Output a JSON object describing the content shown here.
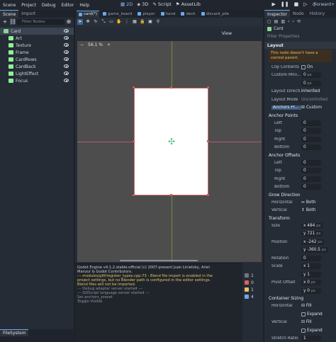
{
  "menubar": {
    "items": [
      "Scene",
      "Project",
      "Debug",
      "Editor",
      "Help"
    ]
  },
  "workspace": {
    "buttons": [
      "2D",
      "3D",
      "Script",
      "AssetLib"
    ],
    "active": "2D"
  },
  "renderer": "Forward+",
  "left_dock": {
    "tabs": [
      "Scene",
      "Import"
    ],
    "filter_placeholder": "Filter Nodes",
    "nodes": [
      {
        "label": "Card",
        "color": "#8bd49b",
        "selected": true
      },
      {
        "label": "Art",
        "color": "#8eef97"
      },
      {
        "label": "Texture",
        "color": "#8eef97"
      },
      {
        "label": "Frame",
        "color": "#8eef97"
      },
      {
        "label": "CardRows",
        "color": "#8eef97"
      },
      {
        "label": "CardBack",
        "color": "#8eef97"
      },
      {
        "label": "LightEffect",
        "color": "#8eef97"
      },
      {
        "label": "Focus",
        "color": "#8eef97"
      }
    ],
    "bottom_tab": "FileSystem"
  },
  "scene_tabs": [
    "card(*)",
    "game_board",
    "player",
    "hand",
    "deck",
    "discard_pile"
  ],
  "viewport": {
    "zoom": "56.1 %",
    "view_label": "View"
  },
  "output": {
    "lines": [
      {
        "text": "Godot Engine v4.1.2.stable.official (c) 2007-present Juan Linietsky, Ariel",
        "cls": ""
      },
      {
        "text": "Manzur & Godot Contributors.",
        "cls": ""
      },
      {
        "text": "--- modules/gltf/register_types.cpp:73 - Blend file import is enabled in the",
        "cls": "warn"
      },
      {
        "text": "project settings, but no Blender path is configured in the editor settings.",
        "cls": "warn"
      },
      {
        "text": "Blend files will not be imported.",
        "cls": "warn"
      },
      {
        "text": "--- Debug adapter server started ---",
        "cls": "dim"
      },
      {
        "text": "--- GDScript language server started ---",
        "cls": "dim"
      },
      {
        "text": "Set anchors_preset",
        "cls": "dim"
      },
      {
        "text": "Toggle Visible",
        "cls": "dim"
      }
    ],
    "counters": [
      "1",
      "0",
      "1",
      "4"
    ]
  },
  "inspector": {
    "tabs": [
      "Inspector",
      "Node",
      "History"
    ],
    "node_name": "Card",
    "filter_placeholder": "Filter Properties",
    "layout_section": "Layout",
    "note": "This node doesn't have a control parent.",
    "clip_contents_label": "Clip Contents",
    "clip_contents_value": "On",
    "custom_min_label": "Custom Mini...",
    "custom_min_x": "0",
    "custom_min_y": "0",
    "layout_direction_label": "Layout Directi...",
    "layout_direction_value": "Inherited",
    "layout_mode_label": "Layout Mode",
    "layout_mode_value": "Uncontrolled",
    "anchors_label": "Anchors Pr...",
    "anchors_value": "Custom",
    "anchor_points_label": "Anchor Points",
    "anchor_points": [
      {
        "label": "Left",
        "value": "0"
      },
      {
        "label": "Top",
        "value": "0"
      },
      {
        "label": "Right",
        "value": "0"
      },
      {
        "label": "Bottom",
        "value": "0"
      }
    ],
    "anchor_offsets_label": "Anchor Offsets",
    "anchor_offsets": [
      {
        "label": "Left",
        "value": "0"
      },
      {
        "label": "Top",
        "value": "0"
      },
      {
        "label": "Right",
        "value": "0"
      },
      {
        "label": "Bottom",
        "value": "0"
      }
    ],
    "grow_label": "Grow Direction",
    "grow_h_label": "Horizontal",
    "grow_h_value": "Both",
    "grow_v_label": "Vertical",
    "grow_v_value": "Both",
    "transform_label": "Transform",
    "size_label": "Size",
    "size_x": "484",
    "size_y": "721",
    "position_label": "Position",
    "position_x": "-242",
    "position_y": "-360.5",
    "rotation_label": "Rotation",
    "rotation_value": "0",
    "scale_label": "Scale",
    "scale_x": "1",
    "scale_y": "1",
    "pivot_label": "Pivot Offset",
    "pivot_x": "0",
    "pivot_y": "0",
    "unit_px": "px",
    "container_label": "Container Sizing",
    "horizontal_label": "Horizontal",
    "fill_value": "Fill",
    "expand_label": "Expand",
    "vertical_label": "Vertical",
    "stretch_label": "Stretch Ratio",
    "stretch_value": "1"
  }
}
